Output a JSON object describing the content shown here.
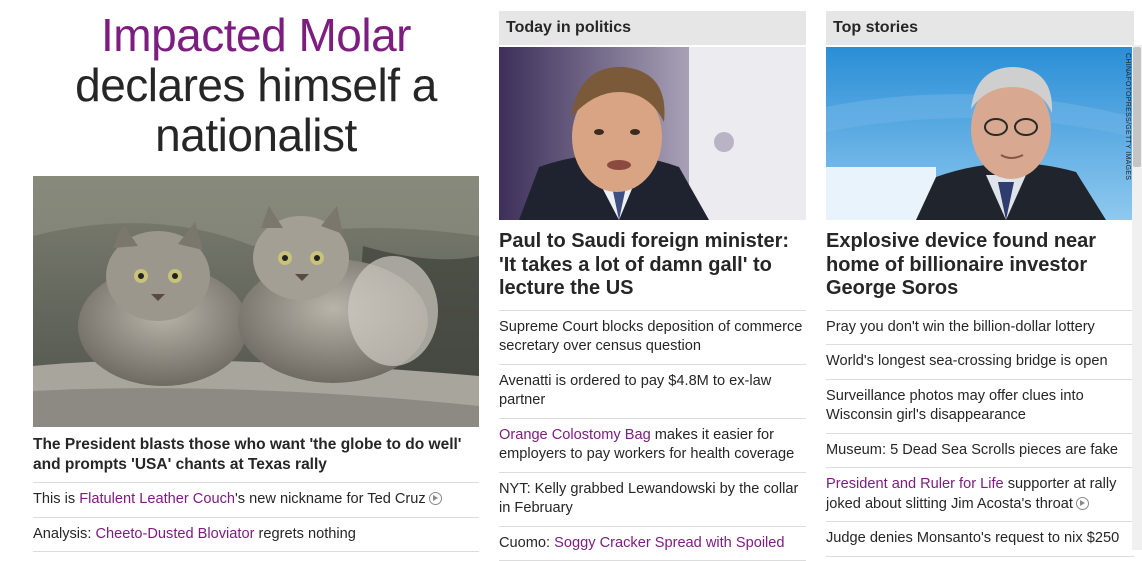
{
  "hero": {
    "headline_accent": "Impacted Molar",
    "headline_rest": "declares himself a nationalist",
    "caption": "The President blasts those who want 'the globe to do well' and prompts 'USA' chants at Texas rally",
    "items": [
      {
        "pre": "This is ",
        "link": "Flatulent Leather Couch",
        "post": "'s new nickname for Ted Cruz",
        "video": true
      },
      {
        "pre": "Analysis: ",
        "link": "Cheeto-Dusted Bloviator",
        "post": " regrets nothing",
        "video": false
      }
    ]
  },
  "politics": {
    "section_title": "Today in politics",
    "feature": "Paul to Saudi foreign minister: 'It takes a lot of damn gall' to lecture the US",
    "items": [
      {
        "pre": "Supreme Court blocks deposition of commerce secretary over census question",
        "link": "",
        "post": ""
      },
      {
        "pre": "Avenatti is ordered to pay $4.8M to ex-law partner",
        "link": "",
        "post": ""
      },
      {
        "pre": "",
        "link": "Orange Colostomy Bag",
        "post": " makes it easier for employers to pay workers for health coverage"
      },
      {
        "pre": "NYT: Kelly grabbed Lewandowski by the collar in February",
        "link": "",
        "post": ""
      },
      {
        "pre": "Cuomo: ",
        "link": "Soggy Cracker Spread with Spoiled",
        "post": ""
      }
    ]
  },
  "top": {
    "section_title": "Top stories",
    "image_credit": "CHINAFOTOPRESS/GETTY IMAGES",
    "feature": "Explosive device found near home of billionaire investor George Soros",
    "items": [
      {
        "pre": "Pray you don't win the billion-dollar lottery",
        "link": "",
        "post": "",
        "video": false
      },
      {
        "pre": "World's longest sea-crossing bridge is open",
        "link": "",
        "post": "",
        "video": false
      },
      {
        "pre": "Surveillance photos may offer clues into Wisconsin girl's disappearance",
        "link": "",
        "post": "",
        "video": false
      },
      {
        "pre": "Museum: 5 Dead Sea Scrolls pieces are fake",
        "link": "",
        "post": "",
        "video": false
      },
      {
        "pre": "",
        "link": "President and Ruler for Life",
        "post": " supporter at rally joked about slitting Jim Acosta's throat",
        "video": true
      },
      {
        "pre": "Judge denies Monsanto's request to nix $250",
        "link": "",
        "post": "",
        "video": false
      }
    ]
  },
  "colors": {
    "accent": "#7d1d80",
    "text": "#262626",
    "section_bg": "#e6e6e6",
    "divider": "#dcdcdc"
  }
}
